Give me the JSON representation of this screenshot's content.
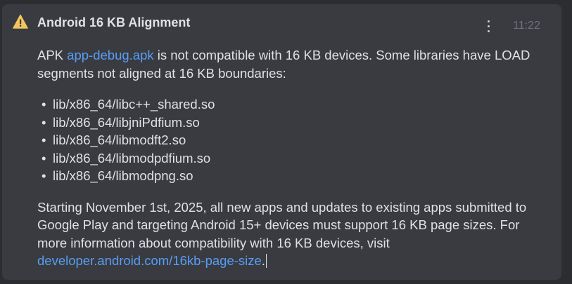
{
  "notification": {
    "title": "Android 16 KB Alignment",
    "time": "11:22",
    "icon": "warning-icon",
    "menu_icon": "more-vertical-icon",
    "intro_prefix": "APK ",
    "apk_name": "app-debug.apk",
    "intro_suffix": " is not compatible with 16 KB devices. Some libraries have LOAD segments not aligned at 16 KB boundaries:",
    "libraries": [
      "lib/x86_64/libc++_shared.so",
      "lib/x86_64/libjniPdfium.so",
      "lib/x86_64/libmodft2.so",
      "lib/x86_64/libmodpdfium.so",
      "lib/x86_64/libmodpng.so"
    ],
    "footer_text": "Starting November 1st, 2025, all new apps and updates to existing apps submitted to Google Play and targeting Android 15+ devices must support 16 KB page sizes. For more information about compatibility with 16 KB devices, visit ",
    "footer_link": "developer.android.com/16kb-page-size",
    "footer_end": "."
  },
  "colors": {
    "background": "#2b2d30",
    "card": "#393b40",
    "text": "#dfe1e5",
    "link": "#589df6",
    "warning": "#f2c55c",
    "muted": "#6f737a"
  }
}
